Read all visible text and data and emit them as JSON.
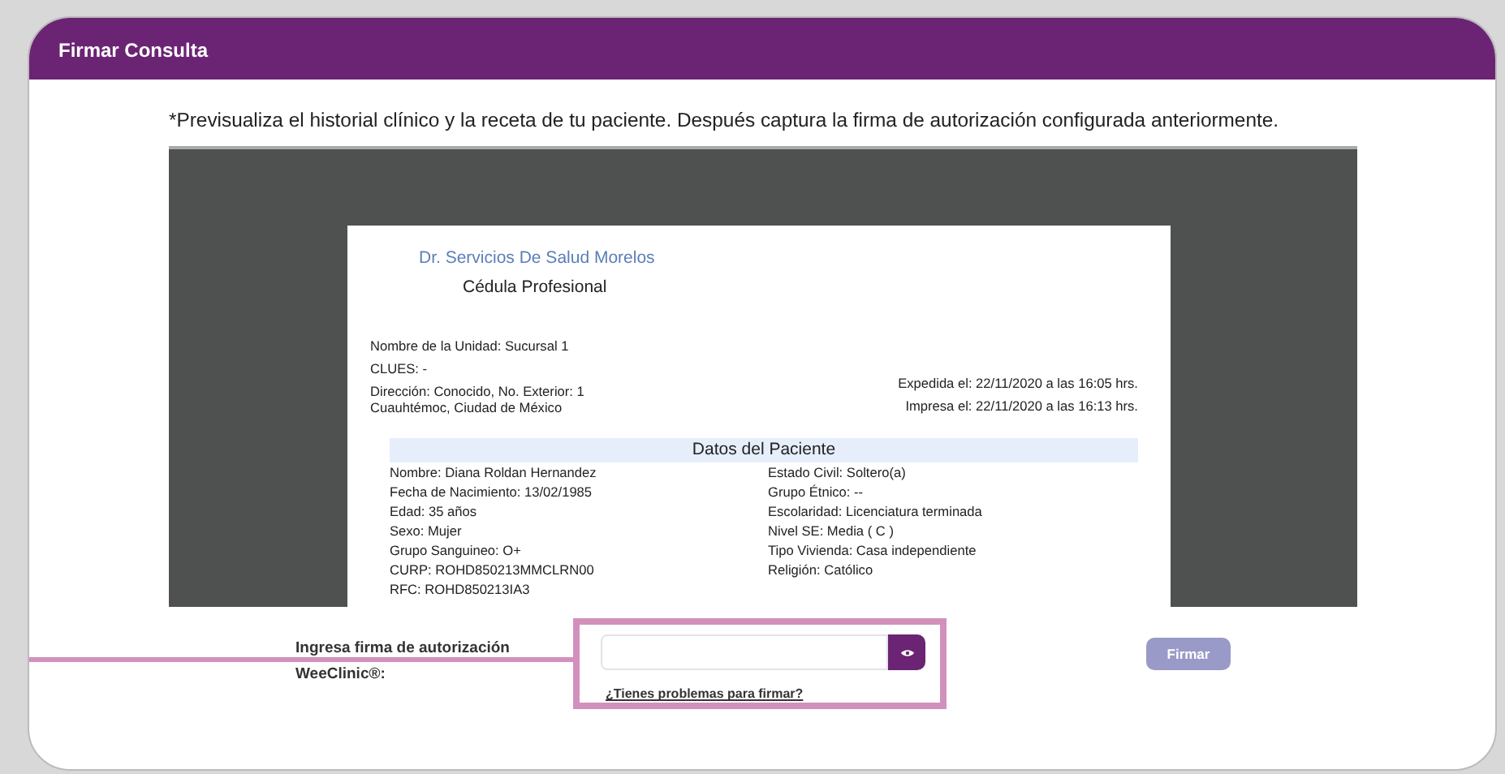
{
  "dialog": {
    "title": "Firmar Consulta",
    "instructions": "*Previsualiza el historial clínico y la receta de tu paciente. Después captura la firma de autorización configurada anteriormente.",
    "document": {
      "doctor": "Dr. Servicios De Salud Morelos",
      "subtitle": "Cédula Profesional",
      "unit_lines": [
        "Nombre de la Unidad: Sucursal 1",
        "CLUES: -",
        "Dirección: Conocido, No. Exterior: 1",
        "Cuauhtémoc, Ciudad de México"
      ],
      "issued_lines": [
        "Expedida el: 22/11/2020 a las 16:05 hrs.",
        "Impresa el: 22/11/2020 a las 16:13 hrs."
      ],
      "section_title": "Datos del Paciente",
      "patient_left": [
        "Nombre: Diana Roldan Hernandez",
        "Fecha de Nacimiento: 13/02/1985",
        "Edad: 35 años",
        "Sexo: Mujer",
        "Grupo Sanguineo: O+",
        "CURP: ROHD850213MMCLRN00",
        "RFC: ROHD850213IA3"
      ],
      "patient_right": [
        "Estado Civil: Soltero(a)",
        "Grupo Étnico: --",
        "Escolaridad: Licenciatura terminada",
        "Nivel SE: Media ( C )",
        "Tipo Vivienda: Casa independiente",
        "Religión: Católico"
      ]
    },
    "signature": {
      "label": "Ingresa firma de autorización WeeClinic®:",
      "help_link": "¿Tienes problemas para firmar?",
      "submit": "Firmar",
      "submit_disabled": true
    }
  }
}
